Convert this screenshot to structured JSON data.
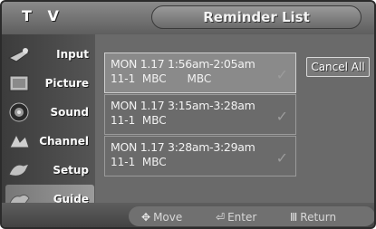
{
  "header": {
    "tv_label": "T V",
    "title": "Reminder List"
  },
  "sidebar": {
    "items": [
      {
        "label": "Input",
        "icon": "input-icon"
      },
      {
        "label": "Picture",
        "icon": "picture-icon"
      },
      {
        "label": "Sound",
        "icon": "sound-icon"
      },
      {
        "label": "Channel",
        "icon": "channel-icon"
      },
      {
        "label": "Setup",
        "icon": "setup-icon"
      },
      {
        "label": "Guide",
        "icon": "guide-icon"
      }
    ],
    "active_index": 5
  },
  "reminders": [
    {
      "line1": "MON 1.17 1:56am-2:05am",
      "line2": "11-1  MBC      MBC",
      "selected": true
    },
    {
      "line1": "MON 1.17 3:15am-3:28am",
      "line2": "11-1  MBC",
      "selected": false
    },
    {
      "line1": "MON 1.17 3:28am-3:29am",
      "line2": "11-1  MBC",
      "selected": false
    }
  ],
  "cancel_all_label": "Cancel All",
  "footer": {
    "move_label": "Move",
    "enter_label": "Enter",
    "return_label": "Return"
  }
}
